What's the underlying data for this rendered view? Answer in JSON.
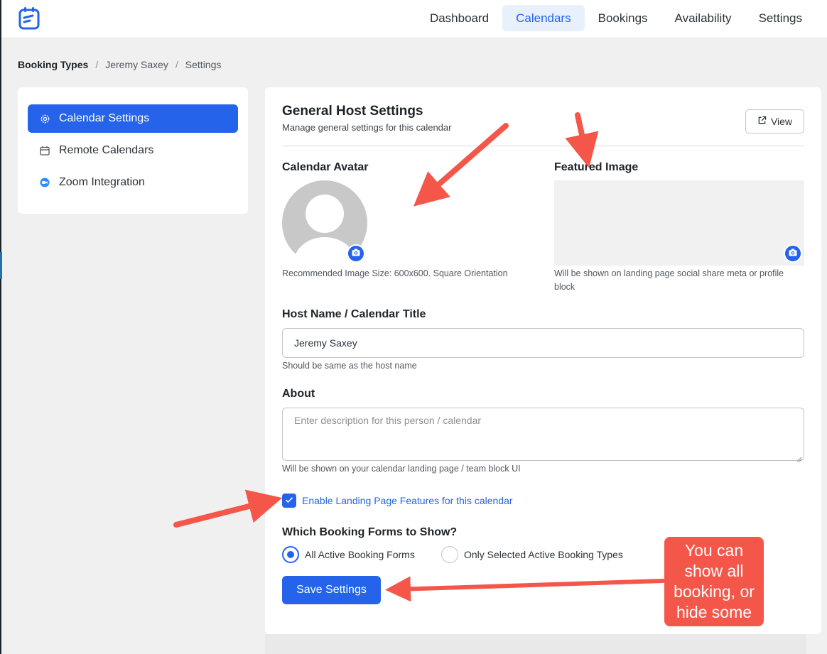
{
  "nav": {
    "items": [
      "Dashboard",
      "Calendars",
      "Bookings",
      "Availability",
      "Settings"
    ],
    "active": "Calendars"
  },
  "breadcrumb": [
    "Booking Types",
    "Jeremy Saxey",
    "Settings"
  ],
  "sidebar": {
    "items": [
      {
        "label": "Calendar Settings",
        "icon": "gear-icon",
        "active": true
      },
      {
        "label": "Remote Calendars",
        "icon": "calendar-icon",
        "active": false
      },
      {
        "label": "Zoom Integration",
        "icon": "zoom-icon",
        "active": false
      }
    ]
  },
  "panel": {
    "title": "General Host Settings",
    "subtitle": "Manage general settings for this calendar",
    "view_label": "View",
    "avatar_label": "Calendar Avatar",
    "avatar_help": "Recommended Image Size: 600x600. Square Orientation",
    "featured_label": "Featured Image",
    "featured_help": "Will be shown on landing page social share meta or profile block",
    "host_label": "Host Name / Calendar Title",
    "host_value": "Jeremy Saxey",
    "host_help": "Should be same as the host name",
    "about_label": "About",
    "about_placeholder": "Enter description for this person / calendar",
    "about_help": "Will be shown on your calendar landing page / team block UI",
    "landing_label": "Enable Landing Page Features for this calendar",
    "landing_checked": true,
    "forms_label": "Which Booking Forms to Show?",
    "forms_options": [
      "All Active Booking Forms",
      "Only Selected Active Booking Types"
    ],
    "forms_selected": "All Active Booking Forms",
    "save_label": "Save Settings"
  },
  "annotation": {
    "callout_lines": [
      "You can",
      "show all",
      "booking, or",
      "hide some"
    ]
  },
  "colors": {
    "accent": "#2563eb",
    "annotation": "#f4574a"
  }
}
